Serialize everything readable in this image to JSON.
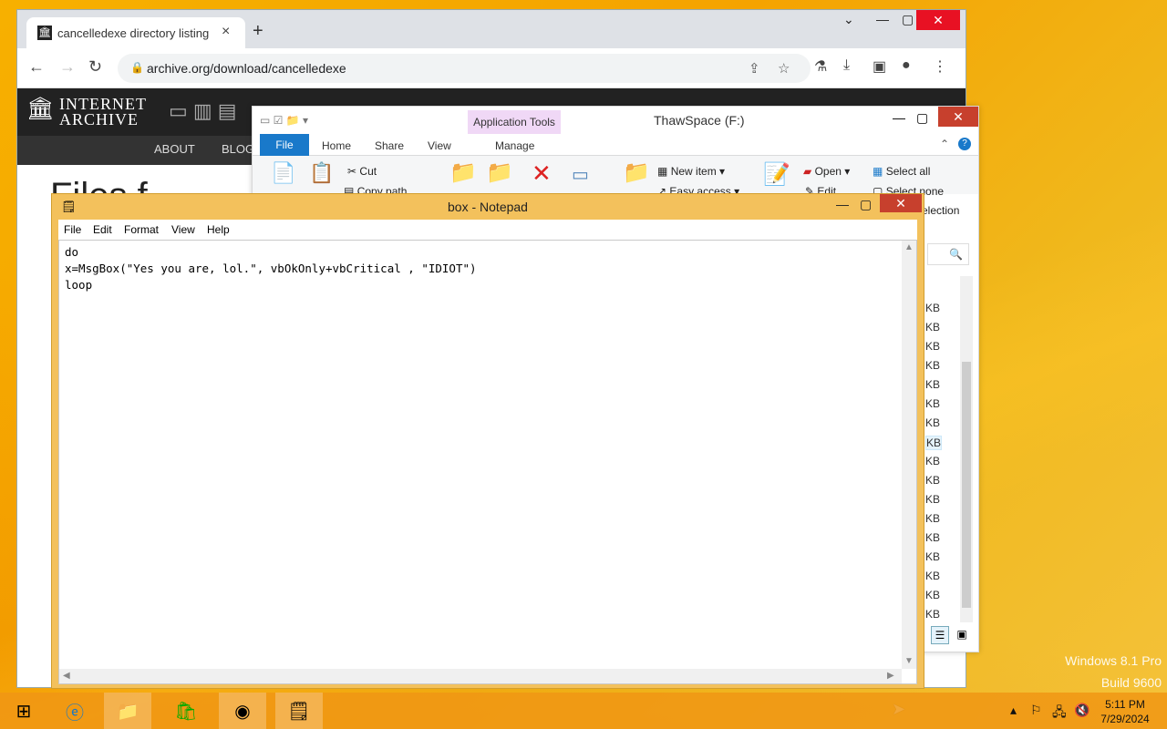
{
  "chrome": {
    "tab_title": "cancelledexe directory listing",
    "url": "archive.org/download/cancelledexe",
    "ia_logo_line1": "INTERNET",
    "ia_logo_line2": "ARCHIVE",
    "nav_about": "ABOUT",
    "nav_blog": "BLOG",
    "page_heading_partial": "Files f"
  },
  "explorer": {
    "title": "ThawSpace (F:)",
    "app_tools": "Application Tools",
    "tabs": [
      "File",
      "Home",
      "Share",
      "View",
      "Manage"
    ],
    "ribbon": {
      "cut": "Cut",
      "copy_path": "Copy path",
      "new_item": "New item",
      "easy_access": "Easy access",
      "open": "Open",
      "edit": "Edit",
      "select_all": "Select all",
      "select_none": "Select none",
      "invert_selection_partial": "election"
    },
    "size_units": [
      "KB",
      "KB",
      "KB",
      "KB",
      "KB",
      "KB",
      "KB",
      "KB",
      "KB",
      "KB",
      "KB",
      "KB",
      "KB",
      "KB",
      "KB",
      "KB",
      "KB"
    ]
  },
  "notepad": {
    "title": "box - Notepad",
    "menus": [
      "File",
      "Edit",
      "Format",
      "View",
      "Help"
    ],
    "content": "do\nx=MsgBox(\"Yes you are, lol.\", vbOkOnly+vbCritical , \"IDIOT\")\nloop"
  },
  "watermark": {
    "line1": "Windows 8.1 Pro",
    "line2": "Build 9600"
  },
  "taskbar": {
    "time": "5:11 PM",
    "date": "7/29/2024"
  }
}
